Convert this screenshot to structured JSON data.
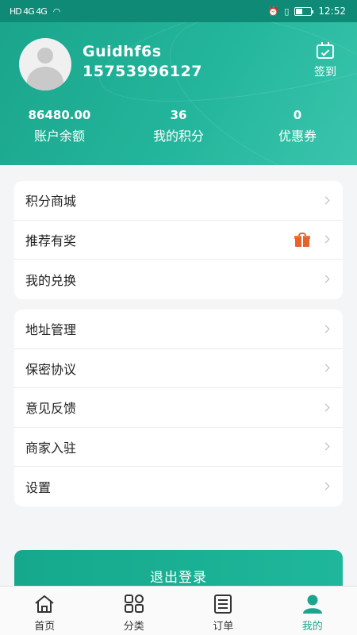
{
  "status_bar": {
    "left_icons": "HD 4G 4G",
    "time": "12:52"
  },
  "profile": {
    "username": "Guidhf6s",
    "phone": "15753996127",
    "checkin_label": "签到"
  },
  "stats": [
    {
      "value": "86480.00",
      "label": "账户余额"
    },
    {
      "value": "36",
      "label": "我的积分"
    },
    {
      "value": "0",
      "label": "优惠券"
    }
  ],
  "menu_group1": [
    {
      "label": "积分商城"
    },
    {
      "label": "推荐有奖"
    },
    {
      "label": "我的兑换"
    }
  ],
  "menu_group2": [
    {
      "label": "地址管理"
    },
    {
      "label": "保密协议"
    },
    {
      "label": "意见反馈"
    },
    {
      "label": "商家入驻"
    },
    {
      "label": "设置"
    }
  ],
  "logout_label": "退出登录",
  "tabs": [
    {
      "label": "首页",
      "icon": "home-icon"
    },
    {
      "label": "分类",
      "icon": "grid-icon"
    },
    {
      "label": "订单",
      "icon": "list-icon"
    },
    {
      "label": "我的",
      "icon": "user-icon",
      "active": true
    }
  ],
  "colors": {
    "accent": "#1aa58c",
    "gift": "#e8622a"
  }
}
